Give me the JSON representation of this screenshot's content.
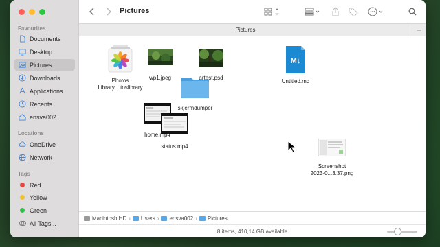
{
  "window": {
    "title": "Pictures",
    "tab_title": "Pictures",
    "status": "8 items, 410,14 GB available",
    "icon_size_level": 0.3
  },
  "sidebar": {
    "favourites_label": "Favourites",
    "favourites": [
      {
        "label": "Documents",
        "icon": "document-icon"
      },
      {
        "label": "Desktop",
        "icon": "desktop-icon"
      },
      {
        "label": "Pictures",
        "icon": "pictures-icon",
        "active": true
      },
      {
        "label": "Downloads",
        "icon": "downloads-icon"
      },
      {
        "label": "Applications",
        "icon": "applications-icon"
      },
      {
        "label": "Recents",
        "icon": "clock-icon"
      },
      {
        "label": "ensva002",
        "icon": "home-icon"
      }
    ],
    "locations_label": "Locations",
    "locations": [
      {
        "label": "OneDrive",
        "icon": "cloud-icon"
      },
      {
        "label": "Network",
        "icon": "globe-icon"
      }
    ],
    "tags_label": "Tags",
    "tags": [
      {
        "label": "Red",
        "color": "#e8453c"
      },
      {
        "label": "Yellow",
        "color": "#f2c12e"
      },
      {
        "label": "Green",
        "color": "#34c04a"
      },
      {
        "label": "All Tags...",
        "icon": "tags-icon"
      }
    ]
  },
  "files": [
    {
      "name": "Photos Library....toslibrary",
      "line1": "Photos",
      "line2": "Library....toslibrary",
      "icon": "photos-library-icon"
    },
    {
      "name": "wp1.jpeg",
      "icon": "image-thumbnail"
    },
    {
      "name": "artest.psd",
      "icon": "image-thumbnail"
    },
    {
      "name": "Untitled.md",
      "icon": "markdown-icon"
    },
    {
      "name": "skjermdumper",
      "icon": "folder-icon"
    },
    {
      "name": "home.mp4",
      "icon": "video-thumbnail"
    },
    {
      "name": "status.mp4",
      "icon": "video-thumbnail"
    },
    {
      "name": "Screenshot 2023-0...3.37.png",
      "line1": "Screenshot",
      "line2": "2023-0...3.37.png",
      "icon": "screenshot-thumbnail"
    }
  ],
  "path": [
    "Macintosh HD",
    "Users",
    "ensva002",
    "Pictures"
  ],
  "colors": {
    "accent": "#3a86e0",
    "folder": "#5aa7e6",
    "sidebar_bg": "#dedcdc"
  }
}
